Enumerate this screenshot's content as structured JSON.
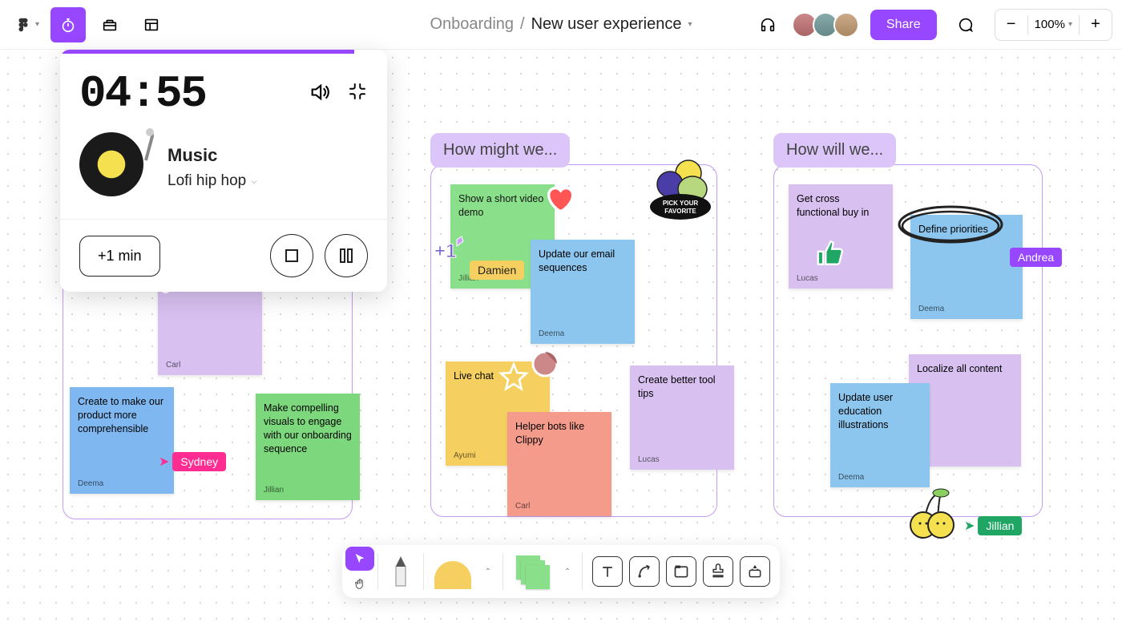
{
  "breadcrumb": {
    "parent": "Onboarding",
    "sep": "/",
    "current": "New user experience"
  },
  "share_label": "Share",
  "zoom": {
    "value": "100%"
  },
  "timer": {
    "time": "04:55",
    "music_heading": "Music",
    "music_genre": "Lofi hip hop",
    "add_min": "+1 min"
  },
  "boards": {
    "b2": {
      "label": "How might we..."
    },
    "b3": {
      "label": "How will we..."
    }
  },
  "stickies": {
    "s_carl_purple": {
      "text": "",
      "author": "Carl"
    },
    "s_create_blue": {
      "text": "Create to make our product more comprehensible",
      "author": "Deema"
    },
    "s_visuals_green": {
      "text": "Make compelling visuals to engage with our onboarding sequence",
      "author": "Jillian"
    },
    "s_short_video": {
      "text": "Show a short video demo",
      "author": "Jillian"
    },
    "s_update_email": {
      "text": "Update our email sequences",
      "author": "Deema"
    },
    "s_live_chat": {
      "text": "Live chat",
      "author": "Ayumi"
    },
    "s_tooltips": {
      "text": "Create better tool tips",
      "author": "Lucas"
    },
    "s_helper": {
      "text": "Helper bots like Clippy",
      "author": "Carl"
    },
    "s_buyin": {
      "text": "Get cross functional buy in",
      "author": "Lucas"
    },
    "s_priorities": {
      "text": "Define priorities",
      "author": "Deema"
    },
    "s_localize": {
      "text": "Localize all content",
      "author": ""
    },
    "s_illustrations": {
      "text": "Update user education illustrations",
      "author": "Deema"
    }
  },
  "cursors": {
    "sydney": {
      "name": "Sydney",
      "color": "#ff2d92"
    },
    "damien": {
      "name": "Damien",
      "color": "#f5d060"
    },
    "andrea": {
      "name": "Andrea",
      "color": "#9747FF"
    },
    "jillian": {
      "name": "Jillian",
      "color": "#1fa564"
    }
  },
  "sticker_text": {
    "pick_favorite": "PICK YOUR FAVORITE"
  }
}
